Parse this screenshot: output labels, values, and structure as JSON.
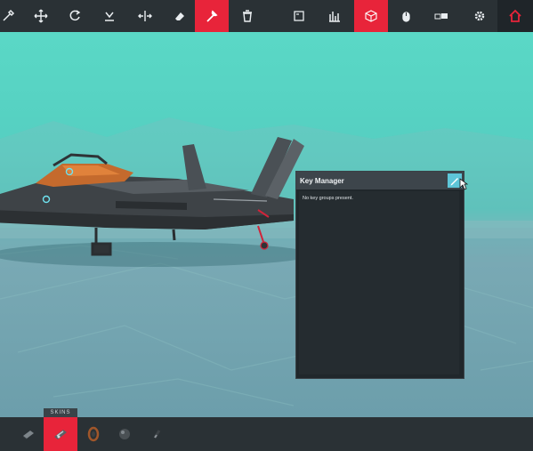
{
  "toolbar": {
    "tools": [
      {
        "name": "pipette-tool",
        "icon": "pipette-icon"
      },
      {
        "name": "move-tool",
        "icon": "move-icon"
      },
      {
        "name": "rotate-tool",
        "icon": "rotate-icon"
      },
      {
        "name": "snap-tool",
        "icon": "snap-icon"
      },
      {
        "name": "mirror-tool",
        "icon": "mirror-icon"
      },
      {
        "name": "eraser-tool",
        "icon": "eraser-icon"
      },
      {
        "name": "wrench-tool",
        "icon": "wrench-icon",
        "active": true
      },
      {
        "name": "delete-tool",
        "icon": "trash-icon"
      },
      {
        "name": "notes-tool",
        "icon": "notes-icon"
      },
      {
        "name": "stats-tool",
        "icon": "bar-chart-icon"
      },
      {
        "name": "block-tool",
        "icon": "cube-icon",
        "active": true
      },
      {
        "name": "mouse-tool",
        "icon": "mouse-icon"
      },
      {
        "name": "keyboard-tool",
        "icon": "keyboard-icon"
      },
      {
        "name": "settings-tool",
        "icon": "gear-icon"
      },
      {
        "name": "home-tool",
        "icon": "home-icon"
      }
    ],
    "accent_color": "#e8243a"
  },
  "key_manager": {
    "title": "Key Manager",
    "empty_message": "No key groups present.",
    "edit_icon": "pencil-icon"
  },
  "bottom_bar": {
    "tab_label": "SKINS",
    "items": [
      {
        "name": "block-category-1",
        "icon": "part-icon"
      },
      {
        "name": "block-category-2",
        "icon": "part-icon",
        "active": true
      },
      {
        "name": "block-category-3",
        "icon": "wheel-icon"
      },
      {
        "name": "block-category-4",
        "icon": "sphere-icon"
      },
      {
        "name": "block-category-5",
        "icon": "rod-icon"
      }
    ]
  }
}
